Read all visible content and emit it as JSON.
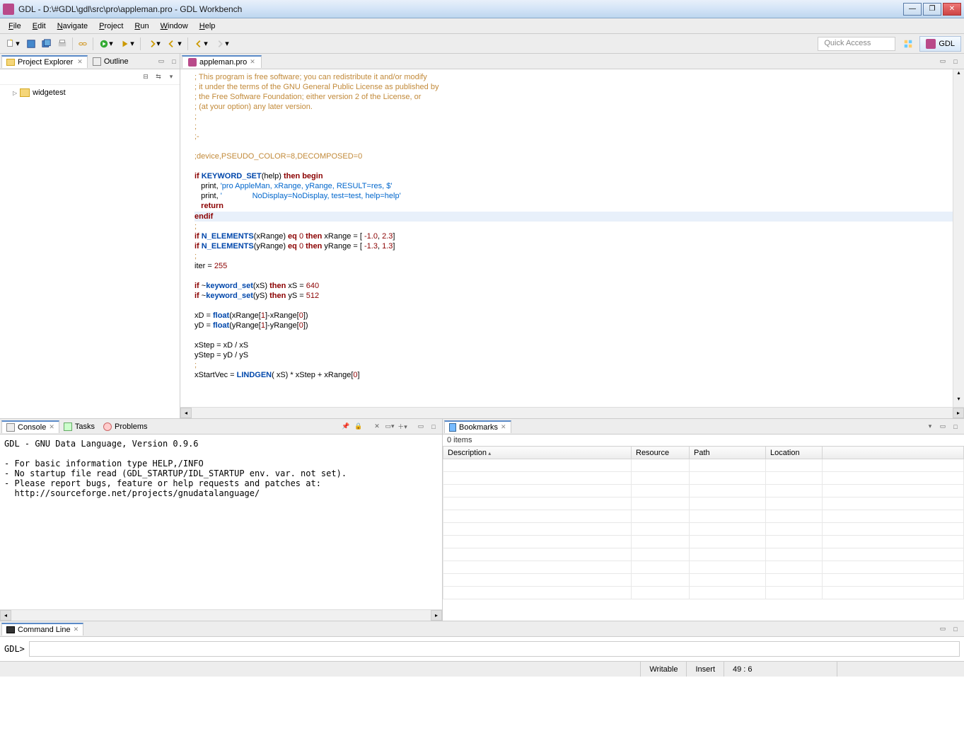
{
  "window": {
    "title": "GDL - D:\\#GDL\\gdl\\src\\pro\\appleman.pro - GDL Workbench"
  },
  "menu": {
    "items": [
      "File",
      "Edit",
      "Navigate",
      "Project",
      "Run",
      "Window",
      "Help"
    ]
  },
  "toolbar": {
    "quick_access": "Quick Access",
    "perspective": "GDL"
  },
  "project_explorer": {
    "tab": "Project Explorer",
    "outline_tab": "Outline",
    "items": [
      {
        "label": "widgetest"
      }
    ]
  },
  "editor": {
    "tab": "appleman.pro",
    "code_lines": [
      {
        "t": "cmt",
        "s": "; This program is free software; you can redistribute it and/or modify"
      },
      {
        "t": "cmt",
        "s": "; it under the terms of the GNU General Public License as published by"
      },
      {
        "t": "cmt",
        "s": "; the Free Software Foundation; either version 2 of the License, or"
      },
      {
        "t": "cmt",
        "s": "; (at your option) any later version."
      },
      {
        "t": "cmt",
        "s": ";"
      },
      {
        "t": "cmt",
        "s": ";"
      },
      {
        "t": "cmt",
        "s": ";-"
      },
      {
        "t": "",
        "s": ""
      },
      {
        "t": "cmt",
        "s": ";device,PSEUDO_COLOR=8,DECOMPOSED=0"
      },
      {
        "t": "",
        "s": ""
      },
      {
        "t": "mix",
        "parts": [
          {
            "c": "kw",
            "s": "if "
          },
          {
            "c": "fn",
            "s": "KEYWORD_SET"
          },
          {
            "c": "",
            "s": "(help) "
          },
          {
            "c": "kw",
            "s": "then begin"
          }
        ]
      },
      {
        "t": "mix",
        "parts": [
          {
            "c": "",
            "s": "   print, "
          },
          {
            "c": "str",
            "s": "'pro AppleMan, xRange, yRange, RESULT=res, $'"
          }
        ]
      },
      {
        "t": "mix",
        "parts": [
          {
            "c": "",
            "s": "   print, "
          },
          {
            "c": "str",
            "s": "'              NoDisplay=NoDisplay, test=test, help=help'"
          }
        ]
      },
      {
        "t": "mix",
        "parts": [
          {
            "c": "kw",
            "s": "   return"
          }
        ]
      },
      {
        "t": "mix",
        "hl": true,
        "parts": [
          {
            "c": "kw",
            "s": "endif"
          }
        ]
      },
      {
        "t": "cmt",
        "s": ";"
      },
      {
        "t": "mix",
        "parts": [
          {
            "c": "kw",
            "s": "if "
          },
          {
            "c": "fn",
            "s": "N_ELEMENTS"
          },
          {
            "c": "",
            "s": "(xRange) "
          },
          {
            "c": "kw",
            "s": "eq "
          },
          {
            "c": "num",
            "s": "0"
          },
          {
            "c": "kw",
            "s": " then"
          },
          {
            "c": "",
            "s": " xRange = [ "
          },
          {
            "c": "num",
            "s": "-1.0"
          },
          {
            "c": "",
            "s": ", "
          },
          {
            "c": "num",
            "s": "2.3"
          },
          {
            "c": "",
            "s": "]"
          }
        ]
      },
      {
        "t": "mix",
        "parts": [
          {
            "c": "kw",
            "s": "if "
          },
          {
            "c": "fn",
            "s": "N_ELEMENTS"
          },
          {
            "c": "",
            "s": "(yRange) "
          },
          {
            "c": "kw",
            "s": "eq "
          },
          {
            "c": "num",
            "s": "0"
          },
          {
            "c": "kw",
            "s": " then"
          },
          {
            "c": "",
            "s": " yRange = [ "
          },
          {
            "c": "num",
            "s": "-1.3"
          },
          {
            "c": "",
            "s": ", "
          },
          {
            "c": "num",
            "s": "1.3"
          },
          {
            "c": "",
            "s": "]"
          }
        ]
      },
      {
        "t": "cmt",
        "s": ";"
      },
      {
        "t": "mix",
        "parts": [
          {
            "c": "",
            "s": "iter = "
          },
          {
            "c": "num",
            "s": "255"
          }
        ]
      },
      {
        "t": "",
        "s": ""
      },
      {
        "t": "mix",
        "parts": [
          {
            "c": "kw",
            "s": "if "
          },
          {
            "c": "",
            "s": "~"
          },
          {
            "c": "fn",
            "s": "keyword_set"
          },
          {
            "c": "",
            "s": "(xS) "
          },
          {
            "c": "kw",
            "s": "then"
          },
          {
            "c": "",
            "s": " xS = "
          },
          {
            "c": "num",
            "s": "640"
          }
        ]
      },
      {
        "t": "mix",
        "parts": [
          {
            "c": "kw",
            "s": "if "
          },
          {
            "c": "",
            "s": "~"
          },
          {
            "c": "fn",
            "s": "keyword_set"
          },
          {
            "c": "",
            "s": "(yS) "
          },
          {
            "c": "kw",
            "s": "then"
          },
          {
            "c": "",
            "s": " yS = "
          },
          {
            "c": "num",
            "s": "512"
          }
        ]
      },
      {
        "t": "",
        "s": ""
      },
      {
        "t": "mix",
        "parts": [
          {
            "c": "",
            "s": "xD = "
          },
          {
            "c": "fn",
            "s": "float"
          },
          {
            "c": "",
            "s": "(xRange["
          },
          {
            "c": "num",
            "s": "1"
          },
          {
            "c": "",
            "s": "]-xRange["
          },
          {
            "c": "num",
            "s": "0"
          },
          {
            "c": "",
            "s": "])"
          }
        ]
      },
      {
        "t": "mix",
        "parts": [
          {
            "c": "",
            "s": "yD = "
          },
          {
            "c": "fn",
            "s": "float"
          },
          {
            "c": "",
            "s": "(yRange["
          },
          {
            "c": "num",
            "s": "1"
          },
          {
            "c": "",
            "s": "]-yRange["
          },
          {
            "c": "num",
            "s": "0"
          },
          {
            "c": "",
            "s": "])"
          }
        ]
      },
      {
        "t": "",
        "s": ""
      },
      {
        "t": "",
        "s": "xStep = xD / xS"
      },
      {
        "t": "",
        "s": "yStep = yD / yS"
      },
      {
        "t": "cmt",
        "s": ";"
      },
      {
        "t": "mix",
        "parts": [
          {
            "c": "",
            "s": "xStartVec = "
          },
          {
            "c": "fn",
            "s": "LINDGEN"
          },
          {
            "c": "",
            "s": "( xS) * xStep + xRange["
          },
          {
            "c": "num",
            "s": "0"
          },
          {
            "c": "",
            "s": "]"
          }
        ]
      }
    ]
  },
  "console": {
    "tab": "Console",
    "tasks_tab": "Tasks",
    "problems_tab": "Problems",
    "text": "GDL - GNU Data Language, Version 0.9.6\n\n- For basic information type HELP,/INFO\n- No startup file read (GDL_STARTUP/IDL_STARTUP env. var. not set).\n- Please report bugs, feature or help requests and patches at:\n  http://sourceforge.net/projects/gnudatalanguage/"
  },
  "bookmarks": {
    "tab": "Bookmarks",
    "count": "0 items",
    "columns": [
      "Description",
      "Resource",
      "Path",
      "Location"
    ]
  },
  "cmdline": {
    "tab": "Command Line",
    "prompt": "GDL>"
  },
  "status": {
    "writable": "Writable",
    "insert": "Insert",
    "pos": "49 : 6"
  }
}
